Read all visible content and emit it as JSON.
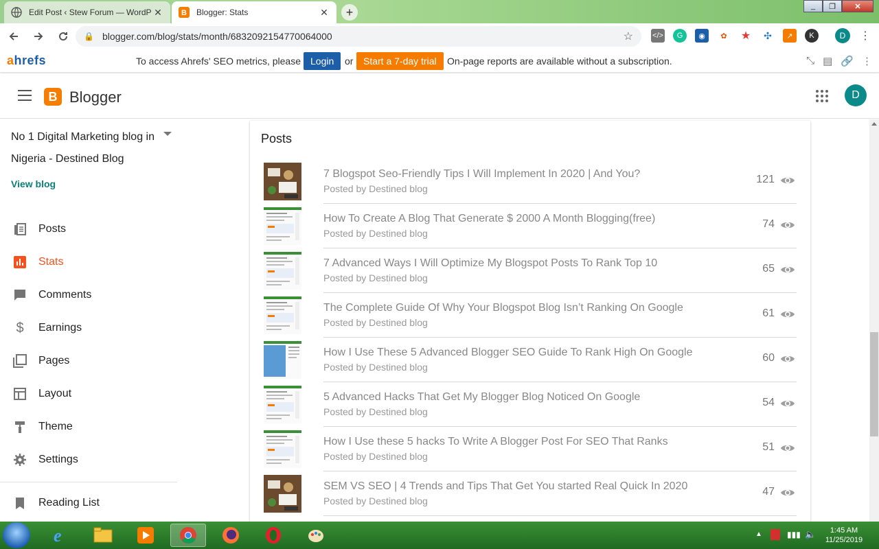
{
  "browser": {
    "tabs": [
      {
        "title": "Edit Post ‹ Stew Forum — WordP",
        "active": false
      },
      {
        "title": "Blogger: Stats",
        "active": true
      }
    ],
    "url": "blogger.com/blog/stats/month/6832092154770064000"
  },
  "ahrefs": {
    "logo_a": "a",
    "logo_rest": "hrefs",
    "message": "To access Ahrefs' SEO metrics, please",
    "login_label": "Login",
    "or_label": "or",
    "trial_label": "Start a 7-day trial",
    "note": "On-page reports are available without a subscription."
  },
  "header": {
    "brand": "Blogger",
    "avatar_letter": "D"
  },
  "sidebar": {
    "blog_name": "No 1 Digital Marketing blog in Nigeria - Destined Blog",
    "view_blog": "View blog",
    "items": [
      {
        "label": "Posts",
        "icon": "posts-icon"
      },
      {
        "label": "Stats",
        "icon": "stats-icon",
        "active": true
      },
      {
        "label": "Comments",
        "icon": "comments-icon"
      },
      {
        "label": "Earnings",
        "icon": "dollar-icon"
      },
      {
        "label": "Pages",
        "icon": "pages-icon"
      },
      {
        "label": "Layout",
        "icon": "layout-icon"
      },
      {
        "label": "Theme",
        "icon": "paint-roller-icon"
      },
      {
        "label": "Settings",
        "icon": "gear-icon"
      },
      {
        "label": "Reading List",
        "icon": "bookmark-icon"
      }
    ]
  },
  "posts_card": {
    "title": "Posts",
    "posts": [
      {
        "title": "7 Blogspot Seo-Friendly Tips I Will Implement In 2020 | And You?",
        "byline": "Posted by Destined blog",
        "views": "121",
        "thumb": "photo"
      },
      {
        "title": "How To Create A Blog That Generate $ 2000 A Month Blogging(free)",
        "byline": "Posted by Destined blog",
        "views": "74",
        "thumb": "screenshot"
      },
      {
        "title": "7 Advanced Ways I Will Optimize My Blogspot Posts To Rank Top 10",
        "byline": "Posted by Destined blog",
        "views": "65",
        "thumb": "screenshot"
      },
      {
        "title": "The Complete Guide Of Why Your Blogspot Blog Isn’t Ranking On Google",
        "byline": "Posted by Destined blog",
        "views": "61",
        "thumb": "screenshot"
      },
      {
        "title": "How I Use These 5 Advanced Blogger SEO Guide To Rank High On Google",
        "byline": "Posted by Destined blog",
        "views": "60",
        "thumb": "blue-screenshot"
      },
      {
        "title": "5 Advanced Hacks That Get My Blogger Blog Noticed On Google",
        "byline": "Posted by Destined blog",
        "views": "54",
        "thumb": "screenshot"
      },
      {
        "title": "How I Use these 5 hacks To Write A Blogger Post For SEO That Ranks",
        "byline": "Posted by Destined blog",
        "views": "51",
        "thumb": "screenshot"
      },
      {
        "title": "SEM VS SEO | 4 Trends and Tips That Get You started Real Quick In 2020",
        "byline": "Posted by Destined blog",
        "views": "47",
        "thumb": "photo"
      }
    ]
  },
  "taskbar": {
    "time": "1:45 AM",
    "date": "11/25/2019"
  },
  "colors": {
    "accent": "#f4511e",
    "teal": "#0b7f7a",
    "ahrefs_blue": "#1d5ea8",
    "ahrefs_orange": "#f57c00"
  }
}
